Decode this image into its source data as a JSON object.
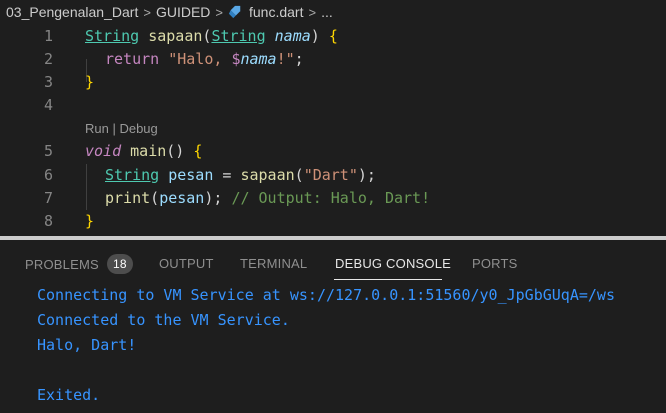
{
  "breadcrumb": {
    "folder": "03_Pengenalan_Dart",
    "subfolder": "GUIDED",
    "file": "func.dart",
    "more": "...",
    "separator": ">"
  },
  "editor": {
    "line_numbers": [
      "1",
      "2",
      "3",
      "4",
      "5",
      "6",
      "7",
      "8"
    ],
    "codelens": "Run | Debug",
    "tokens": {
      "l1_type": "String",
      "l1_fn": "sapaan",
      "l1_open": "(",
      "l1_ptype": "String",
      "l1_param": "nama",
      "l1_close": ")",
      "l1_brace": "{",
      "l2_return": "return",
      "l2_str1": "\"Halo, ",
      "l2_dollar": "$",
      "l2_interp": "nama",
      "l2_str2": "!\"",
      "l2_semi": ";",
      "l3_brace": "}",
      "l5_void": "void",
      "l5_fn": "main",
      "l5_parens": "()",
      "l5_brace": "{",
      "l6_type": "String",
      "l6_var": "pesan",
      "l6_eq": "=",
      "l6_fn": "sapaan",
      "l6_open": "(",
      "l6_str": "\"Dart\"",
      "l6_close": ");",
      "l7_fn": "print",
      "l7_open": "(",
      "l7_var": "pesan",
      "l7_close": ");",
      "l7_comment": "// Output: Halo, Dart!",
      "l8_brace": "}"
    }
  },
  "panel": {
    "tabs": {
      "problems": "PROBLEMS",
      "problems_count": "18",
      "output": "OUTPUT",
      "terminal": "TERMINAL",
      "debug_console": "DEBUG CONSOLE",
      "ports": "PORTS"
    },
    "console_lines": [
      "Connecting to VM Service at ws://127.0.0.1:51560/y0_JpGbGUqA=/ws",
      "Connected to the VM Service.",
      "Halo, Dart!",
      "Exited."
    ]
  },
  "colors": {
    "background": "#1e1e1e",
    "console_text": "#3794ff",
    "type": "#4ec9b0",
    "function": "#dcdcaa",
    "keyword": "#c586c0",
    "string": "#ce9178",
    "variable": "#9cdcfe",
    "comment": "#6a9955",
    "bracket": "#ffd700"
  },
  "icons": {
    "file_icon": "dart-icon",
    "separator_icon": "chevron-right-icon"
  }
}
